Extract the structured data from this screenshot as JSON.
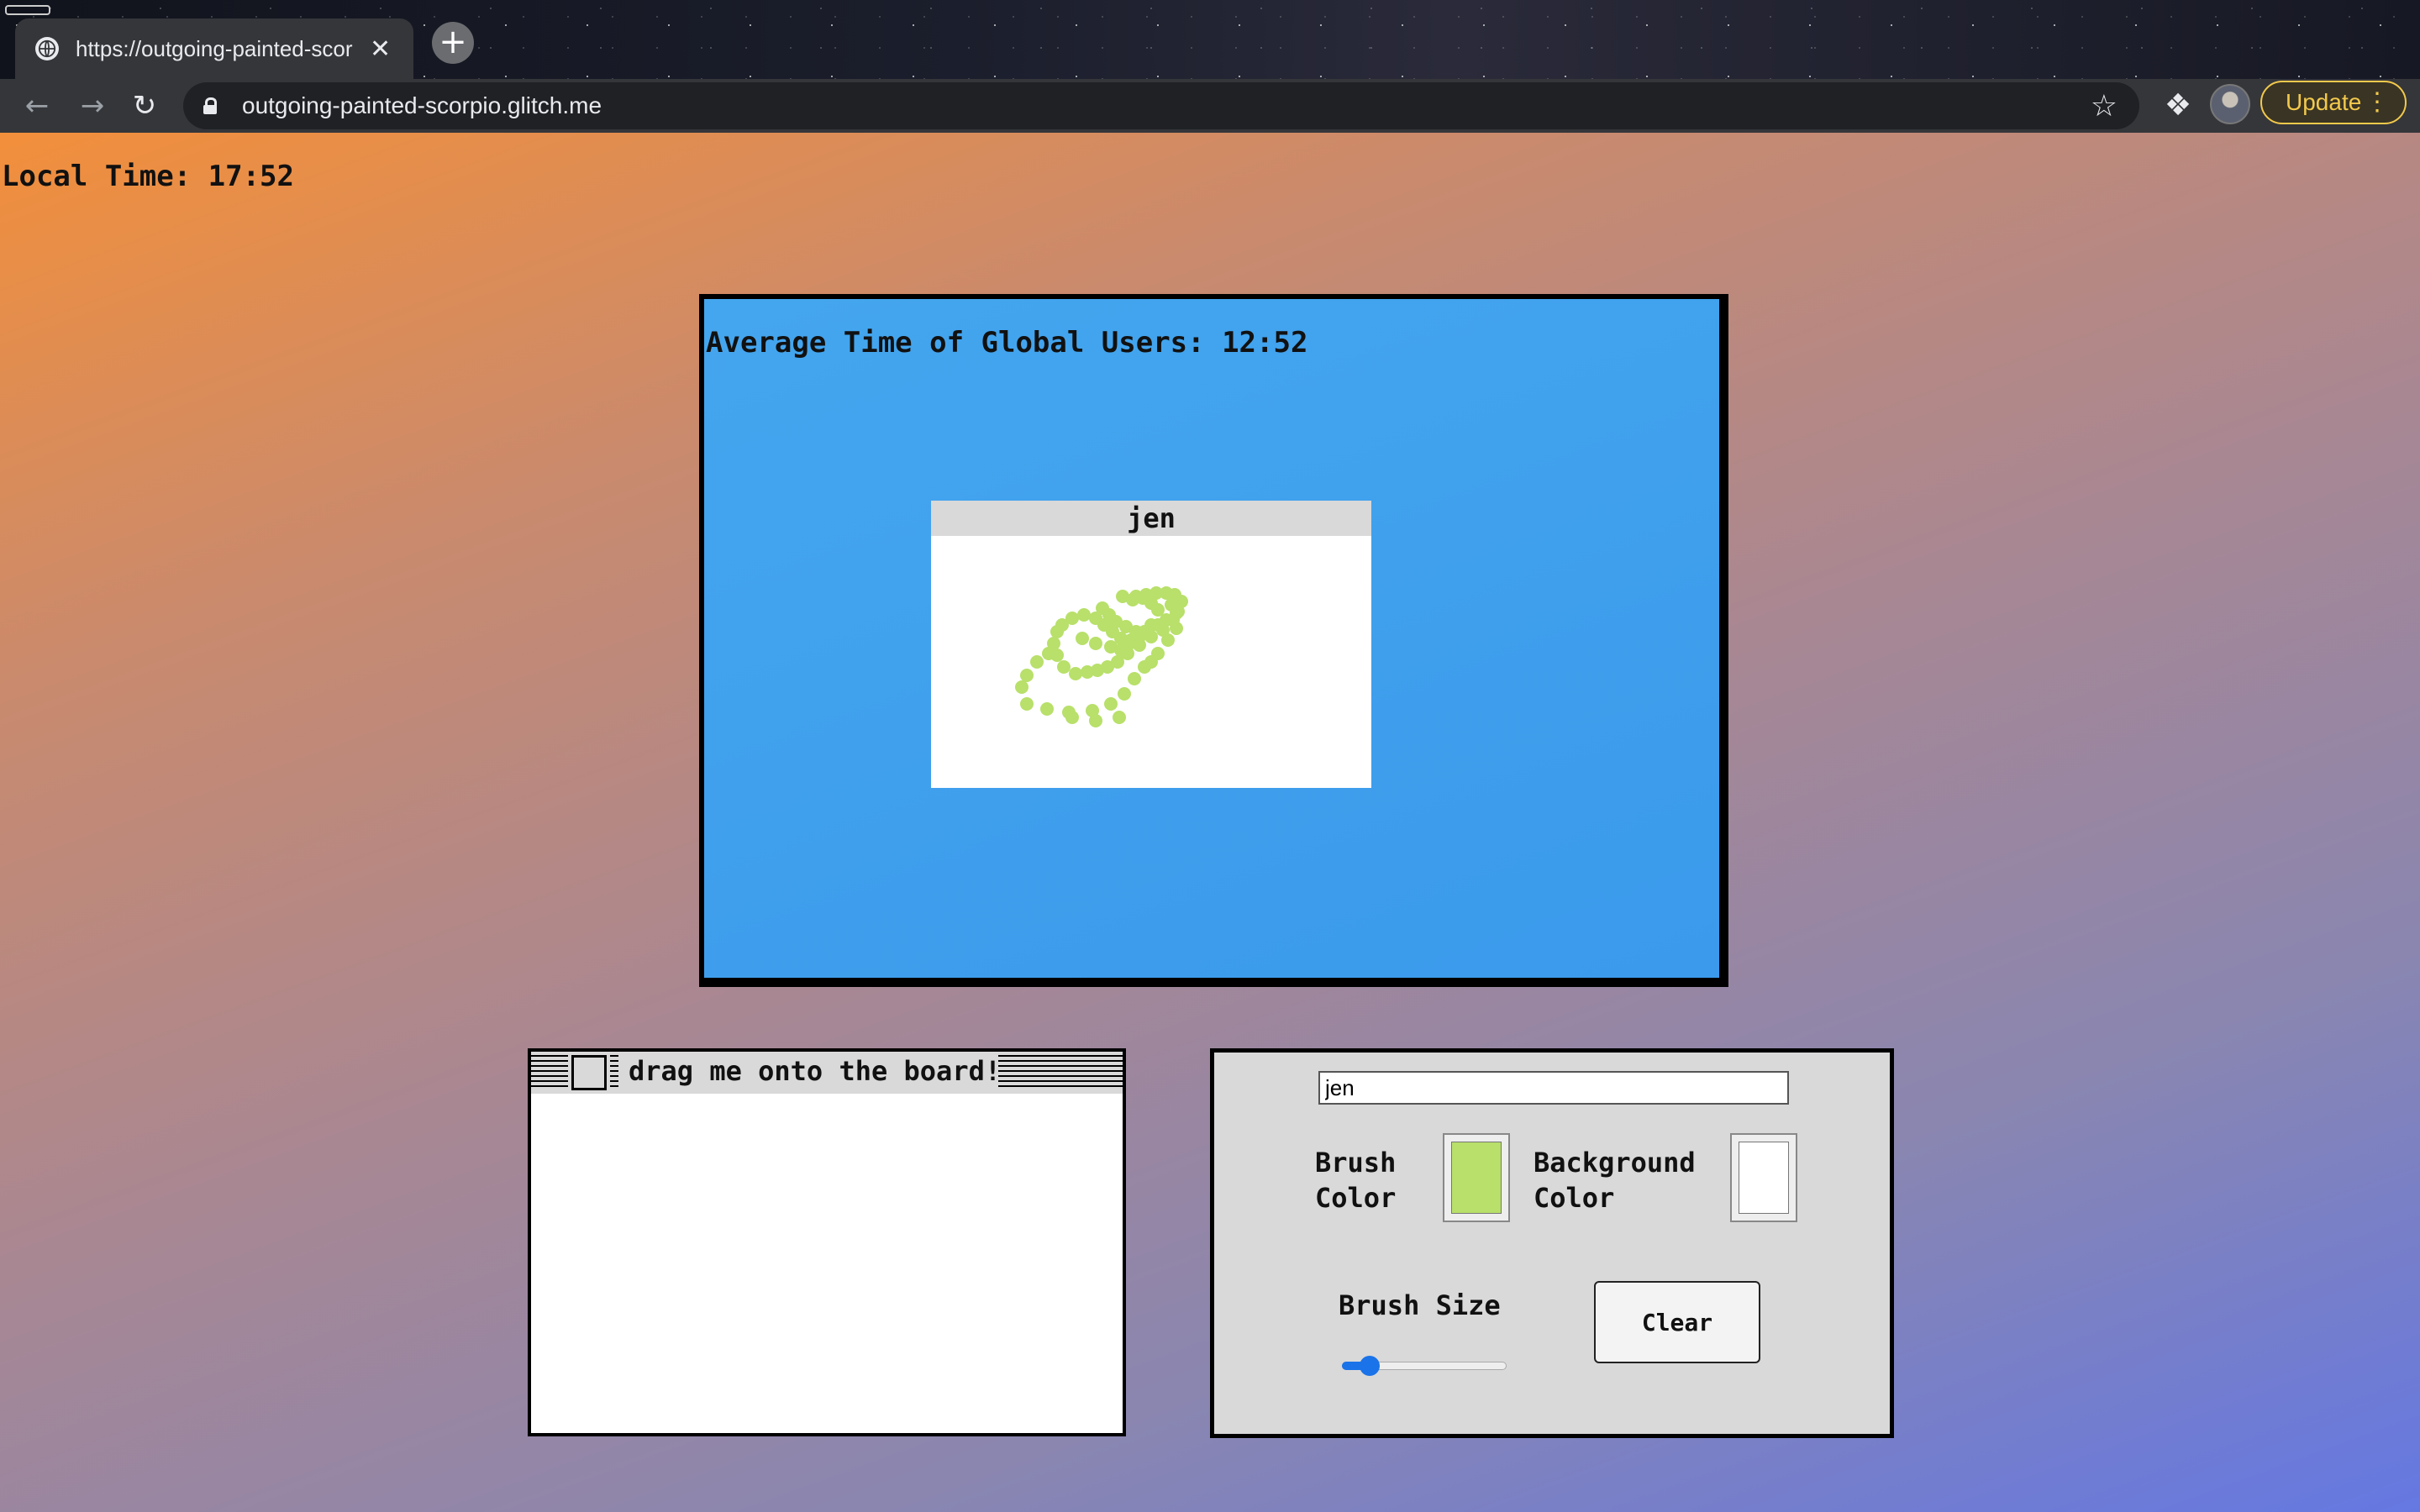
{
  "browser": {
    "tab_title": "https://outgoing-painted-scorpio.glitch.me",
    "tab_close": "✕",
    "new_tab": "+",
    "url": "outgoing-painted-scorpio.glitch.me",
    "update_label": "Update",
    "icons": [
      "globe-icon",
      "back-arrow-icon",
      "forward-arrow-icon",
      "reload-icon",
      "lock-icon",
      "star-icon",
      "puzzle-extension-icon",
      "profile-avatar",
      "more-vert-icon"
    ]
  },
  "page": {
    "local_time": "Local Time: 17:52",
    "board": {
      "average_time": "Average Time of Global Users: 12:52",
      "card": {
        "name": "jen",
        "stroke_color": "#b8e06a"
      }
    },
    "drag_window": {
      "title": "drag me onto the board!"
    },
    "controls": {
      "name_value": "jen",
      "brush_color_label": "Brush Color",
      "brush_color": "#b8e06a",
      "background_color_label": "Background Color",
      "background_color": "#ffffff",
      "brush_size_label": "Brush Size",
      "brush_size_fraction": 0.12,
      "clear_label": "Clear"
    }
  },
  "colors": {
    "board_blue": "#3fa0ee",
    "gradient_start": "#f28f3b",
    "gradient_end": "#6578e2"
  }
}
